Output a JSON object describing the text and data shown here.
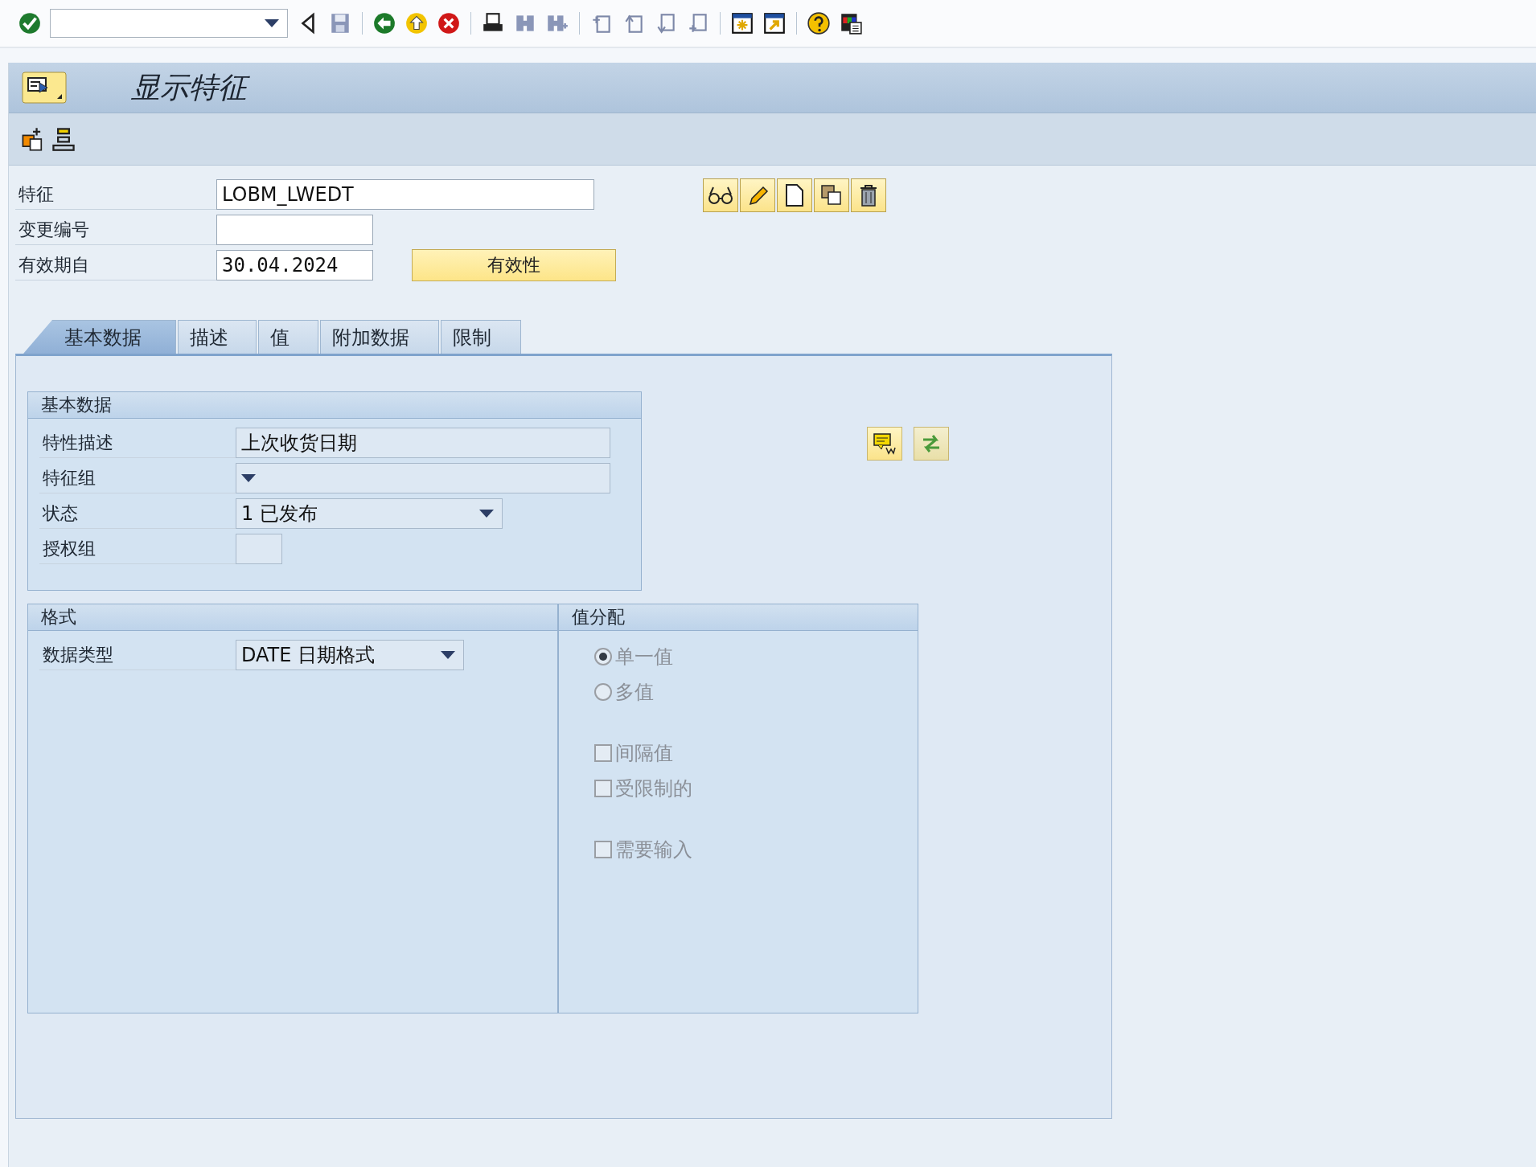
{
  "screen_title": "显示特征",
  "header_fields": [
    {
      "label": "特征",
      "value": "LOBM_LWEDT"
    },
    {
      "label": "变更编号"
    },
    {
      "label": "有效期自",
      "value": "30.04.2024"
    }
  ],
  "validity_button": "有效性",
  "tabs": [
    {
      "label": "基本数据",
      "selected": true
    },
    {
      "label": "描述",
      "selected": false
    },
    {
      "label": "值",
      "selected": false
    },
    {
      "label": "附加数据",
      "selected": false
    },
    {
      "label": "限制",
      "selected": false
    }
  ],
  "basic_data": {
    "title": "基本数据",
    "fields": [
      {
        "label": "特性描述",
        "value": "上次收货日期",
        "kind": "text"
      },
      {
        "label": "特征组",
        "kind": "dropdown"
      },
      {
        "label": "状态",
        "value": "1 已发布",
        "kind": "dropdown"
      },
      {
        "label": "授权组",
        "kind": "text"
      }
    ]
  },
  "format": {
    "title": "格式",
    "fields": [
      {
        "label": "数据类型",
        "value": "DATE 日期格式",
        "kind": "dropdown"
      }
    ]
  },
  "value_assignment": {
    "title": "值分配",
    "option_groups": [
      {
        "options": [
          {
            "label": "单一值",
            "kind": "radio",
            "selected": true,
            "disabled": true
          },
          {
            "label": "多值",
            "kind": "radio",
            "selected": false,
            "disabled": true
          }
        ]
      },
      {
        "options": [
          {
            "label": "间隔值",
            "kind": "checkbox",
            "checked": false,
            "disabled": true
          },
          {
            "label": "受限制的",
            "kind": "checkbox",
            "checked": false,
            "disabled": true
          }
        ]
      },
      {
        "options": [
          {
            "label": "需要输入",
            "kind": "checkbox",
            "checked": false,
            "disabled": true
          }
        ]
      }
    ]
  }
}
